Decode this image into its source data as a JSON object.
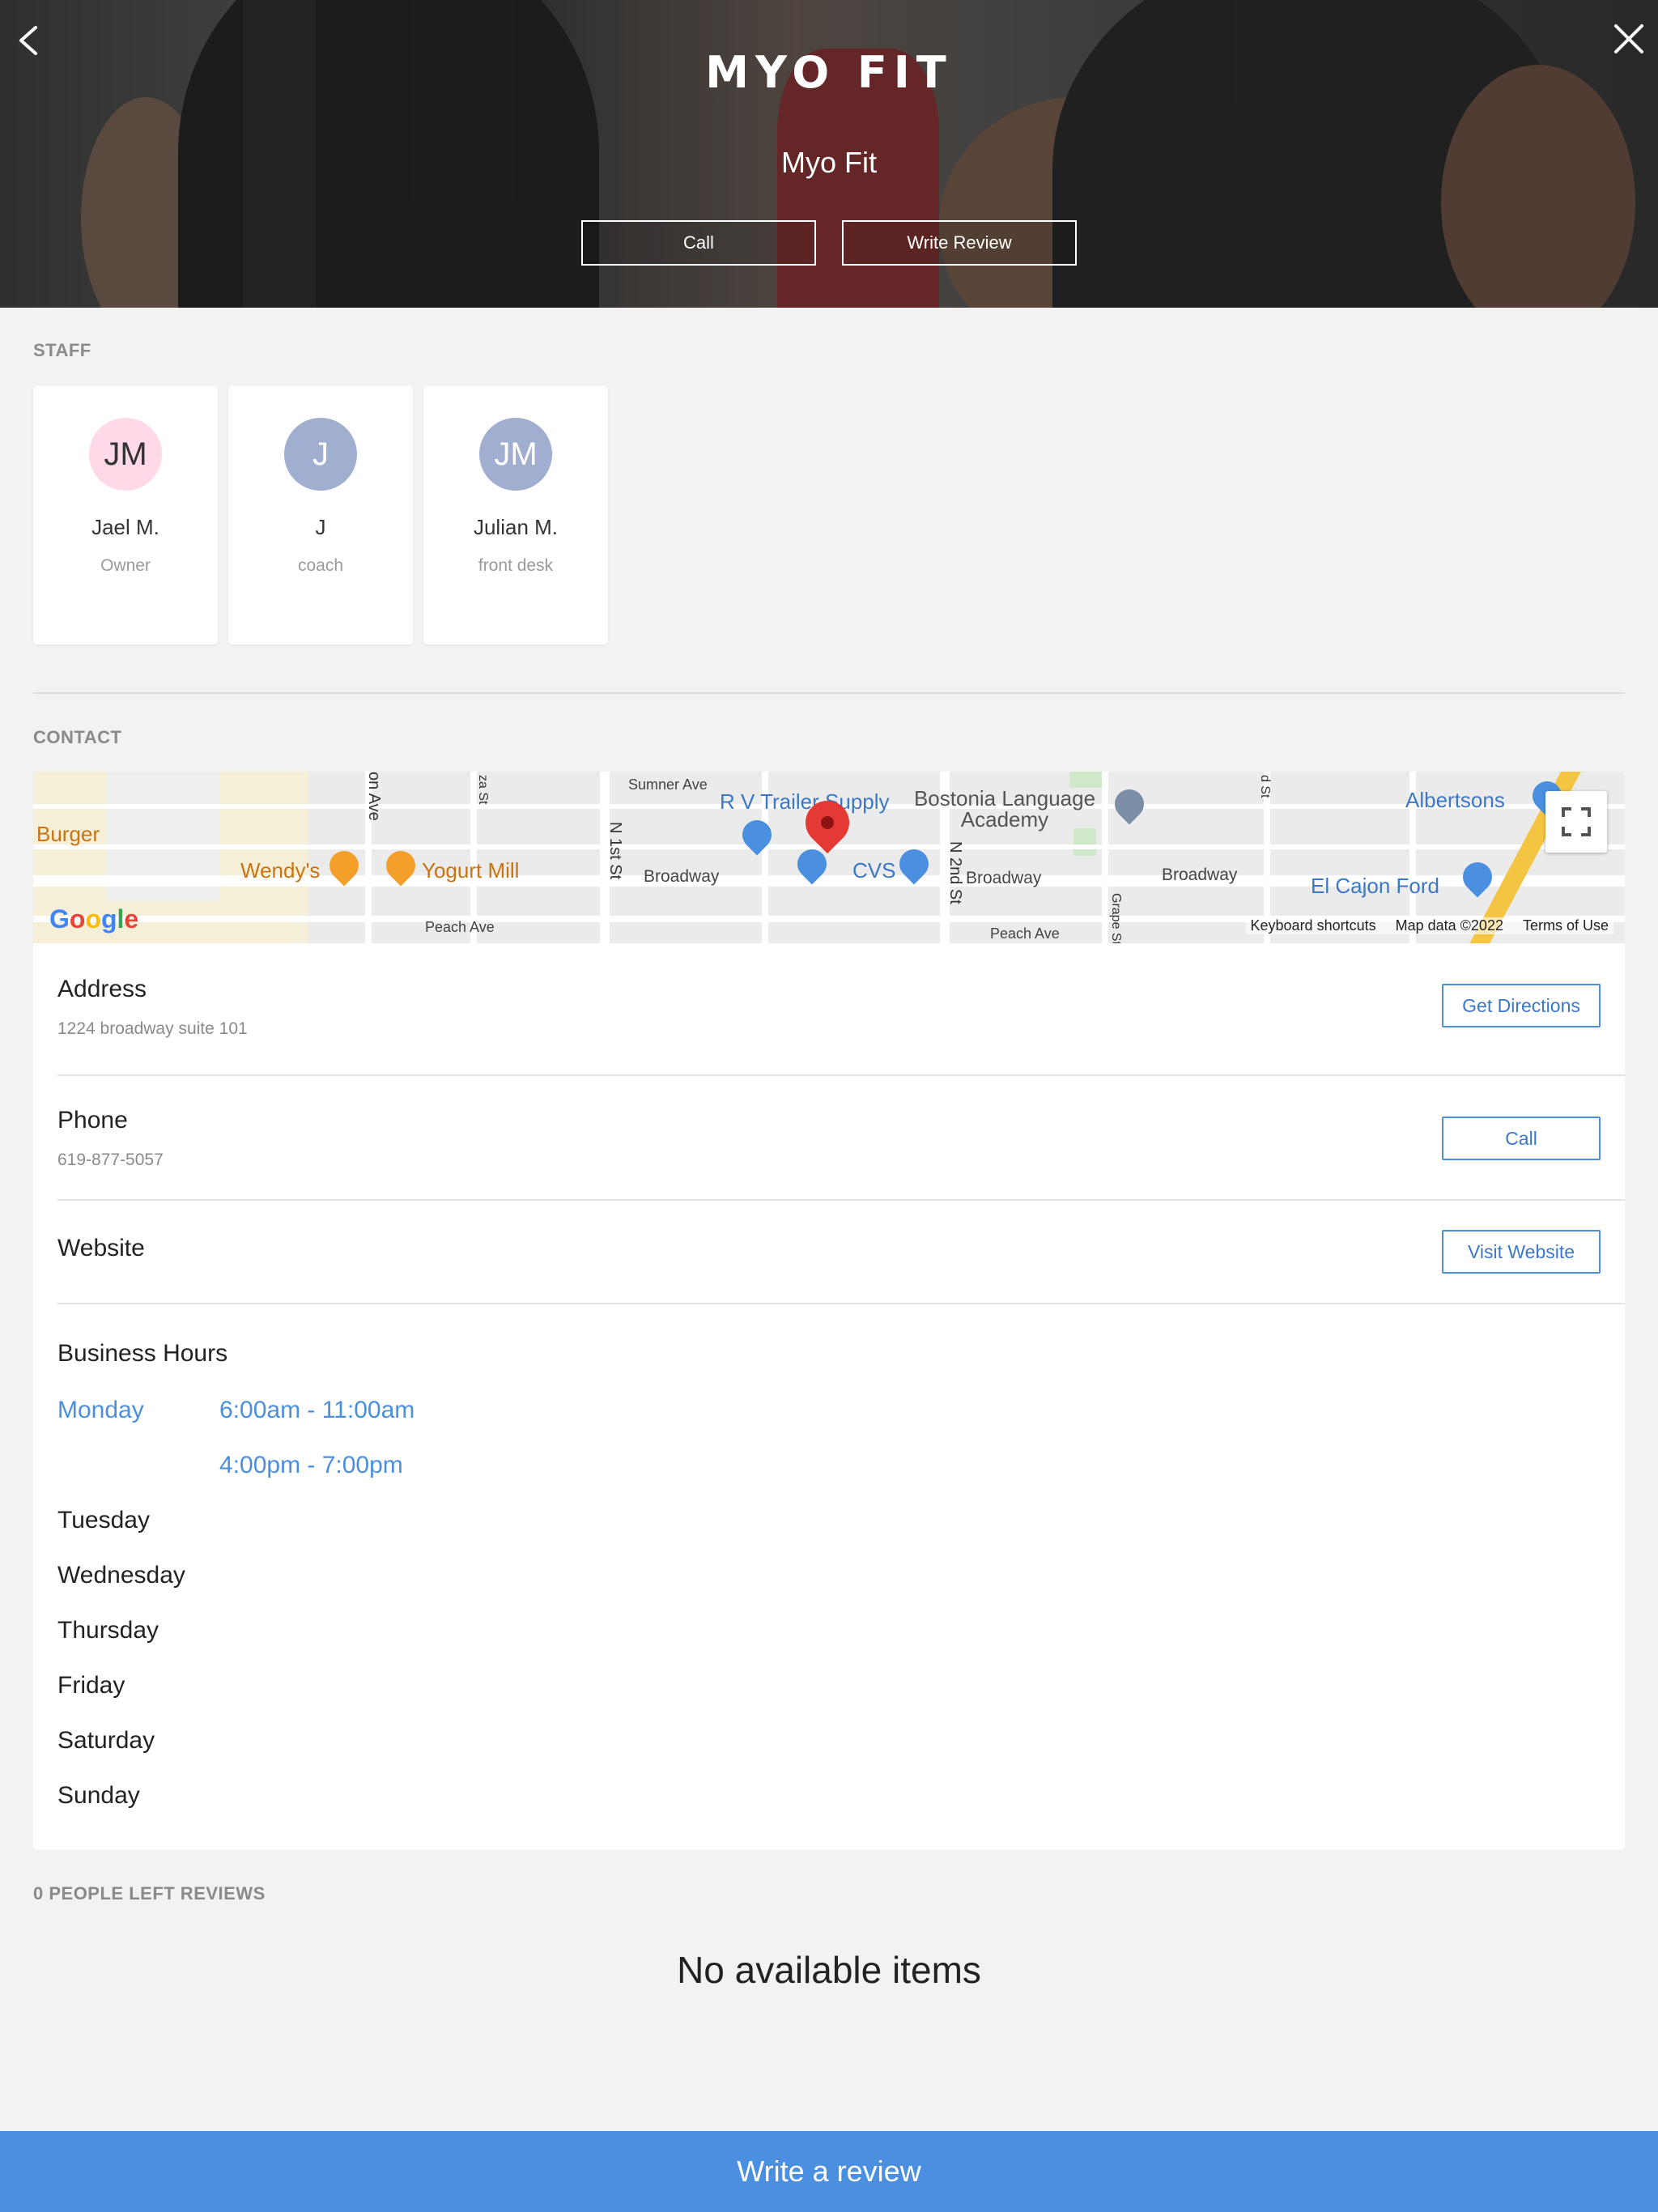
{
  "header": {
    "logo_text": "MYO FIT",
    "title": "Myo Fit",
    "call_label": "Call",
    "write_review_label": "Write Review",
    "back_icon": "chevron-left-icon",
    "close_icon": "close-icon"
  },
  "staff": {
    "label": "STAFF",
    "members": [
      {
        "initials": "JM",
        "name": "Jael M.",
        "role": "Owner",
        "color": "#ffd9e7"
      },
      {
        "initials": "J",
        "name": "J",
        "role": "coach",
        "color": "#a0aed0"
      },
      {
        "initials": "JM",
        "name": "Julian M.",
        "role": "front desk",
        "color": "#a0aed0"
      }
    ]
  },
  "contact": {
    "label": "CONTACT",
    "map": {
      "labels": [
        "Burger",
        "Wendy's",
        "Yogurt Mill",
        "Broadway",
        "CVS",
        "R V Trailer Supply",
        "Bostonia Language Academy",
        "Albertsons",
        "El Cajon Ford",
        "Sumner Ave",
        "Peach Ave",
        "N 1st St",
        "N 2nd St",
        "Grape St",
        "on Ave",
        "za St",
        "d St"
      ],
      "keyboard_shortcuts": "Keyboard shortcuts",
      "map_data": "Map data ©2022",
      "terms": "Terms of Use",
      "google": "Google"
    },
    "address": {
      "title": "Address",
      "value": "1224 broadway suite 101",
      "button": "Get Directions"
    },
    "phone": {
      "title": "Phone",
      "value": "619-877-5057",
      "button": "Call"
    },
    "website": {
      "title": "Website",
      "button": "Visit Website"
    },
    "hours": {
      "title": "Business Hours",
      "days": [
        {
          "day": "Monday",
          "slots": [
            "6:00am - 11:00am",
            "4:00pm - 7:00pm"
          ]
        },
        {
          "day": "Tuesday",
          "slots": []
        },
        {
          "day": "Wednesday",
          "slots": []
        },
        {
          "day": "Thursday",
          "slots": []
        },
        {
          "day": "Friday",
          "slots": []
        },
        {
          "day": "Saturday",
          "slots": []
        },
        {
          "day": "Sunday",
          "slots": []
        }
      ]
    }
  },
  "reviews": {
    "label": "0 PEOPLE LEFT REVIEWS",
    "empty": "No available items"
  },
  "footer": {
    "write_review": "Write a review"
  },
  "colors": {
    "accent": "#4a8fe0",
    "background": "#f1f2f1"
  }
}
